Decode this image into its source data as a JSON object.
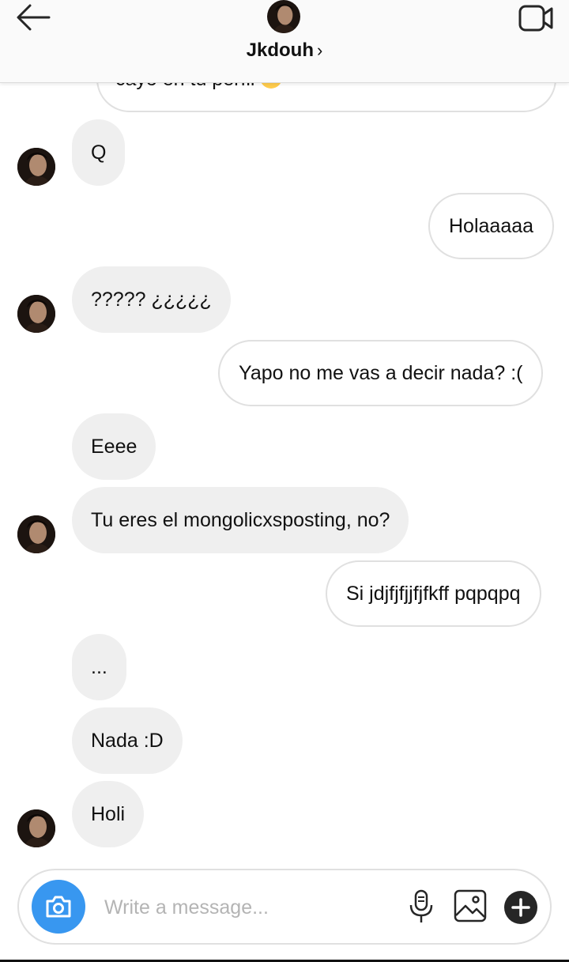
{
  "header": {
    "title": "Jkdouh",
    "chevron": "›",
    "back_icon": "arrow-left-icon",
    "video_icon": "video-camera-icon"
  },
  "messages": [
    {
      "side": "out",
      "text": "cayo en tu perfil",
      "clipped": true
    },
    {
      "side": "in",
      "text": "Q"
    },
    {
      "side": "out",
      "text": "Holaaaaa"
    },
    {
      "side": "in",
      "text": "????? ¿¿¿¿¿"
    },
    {
      "side": "out",
      "text": "Yapo no me vas a decir nada? :("
    },
    {
      "side": "in",
      "text": "Eeee"
    },
    {
      "side": "in",
      "text": "Tu eres el mongolicxsposting, no?"
    },
    {
      "side": "out",
      "text": "Si jdjfjfjjfjfkff pqpqpq"
    },
    {
      "side": "in",
      "text": "..."
    },
    {
      "side": "in",
      "text": "Nada :D"
    },
    {
      "side": "in",
      "text": "Holi"
    }
  ],
  "composer": {
    "placeholder": "Write a message...",
    "value": "",
    "camera_icon": "camera-icon",
    "mic_icon": "microphone-icon",
    "gallery_icon": "image-gallery-icon",
    "plus_icon": "plus-icon",
    "accent": "#3897f0"
  }
}
